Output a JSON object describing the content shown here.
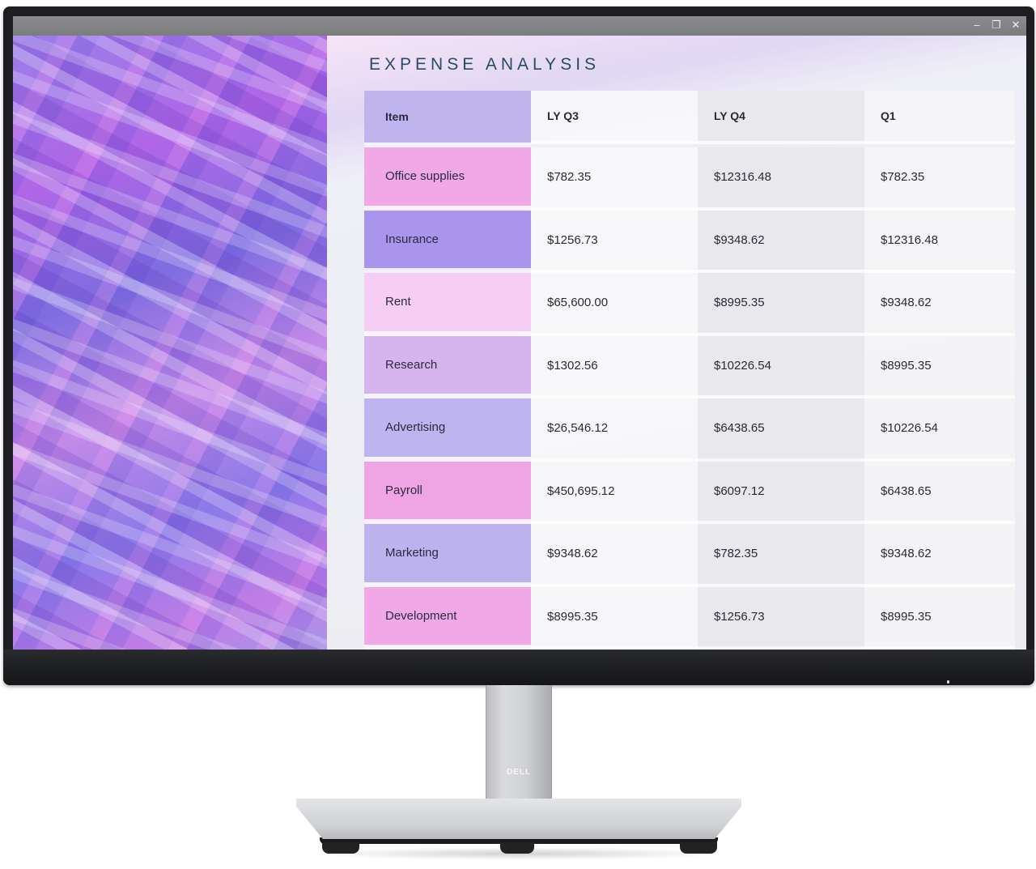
{
  "window": {
    "controls": {
      "minimize_icon": "–",
      "restore_icon": "❐",
      "close_icon": "✕"
    }
  },
  "page": {
    "title": "EXPENSE ANALYSIS"
  },
  "table": {
    "headers": [
      "Item",
      "LY Q3",
      "LY Q4",
      "Q1"
    ],
    "rows": [
      {
        "item": "Office supplies",
        "item_color": "#f0a8e6",
        "values": [
          "$782.35",
          "$12316.48",
          "$782.35"
        ]
      },
      {
        "item": "Insurance",
        "item_color": "#a996ec",
        "values": [
          "$1256.73",
          "$9348.62",
          "$12316.48"
        ]
      },
      {
        "item": "Rent",
        "item_color": "#f6cdf4",
        "values": [
          "$65,600.00",
          "$8995.35",
          "$9348.62"
        ]
      },
      {
        "item": "Research",
        "item_color": "#d6b4ee",
        "values": [
          "$1302.56",
          "$10226.54",
          "$8995.35"
        ]
      },
      {
        "item": "Advertising",
        "item_color": "#bdb4f0",
        "values": [
          "$26,546.12",
          "$6438.65",
          "$10226.54"
        ]
      },
      {
        "item": "Payroll",
        "item_color": "#efa4e4",
        "values": [
          "$450,695.12",
          "$6097.12",
          "$6438.65"
        ]
      },
      {
        "item": "Marketing",
        "item_color": "#bbb2ee",
        "values": [
          "$9348.62",
          "$782.35",
          "$9348.62"
        ]
      },
      {
        "item": "Development",
        "item_color": "#f0a8e6",
        "values": [
          "$8995.35",
          "$1256.73",
          "$8995.35"
        ]
      }
    ],
    "header_item_color": "#c0b4ee"
  },
  "hardware": {
    "brand_logo": "DELL"
  }
}
